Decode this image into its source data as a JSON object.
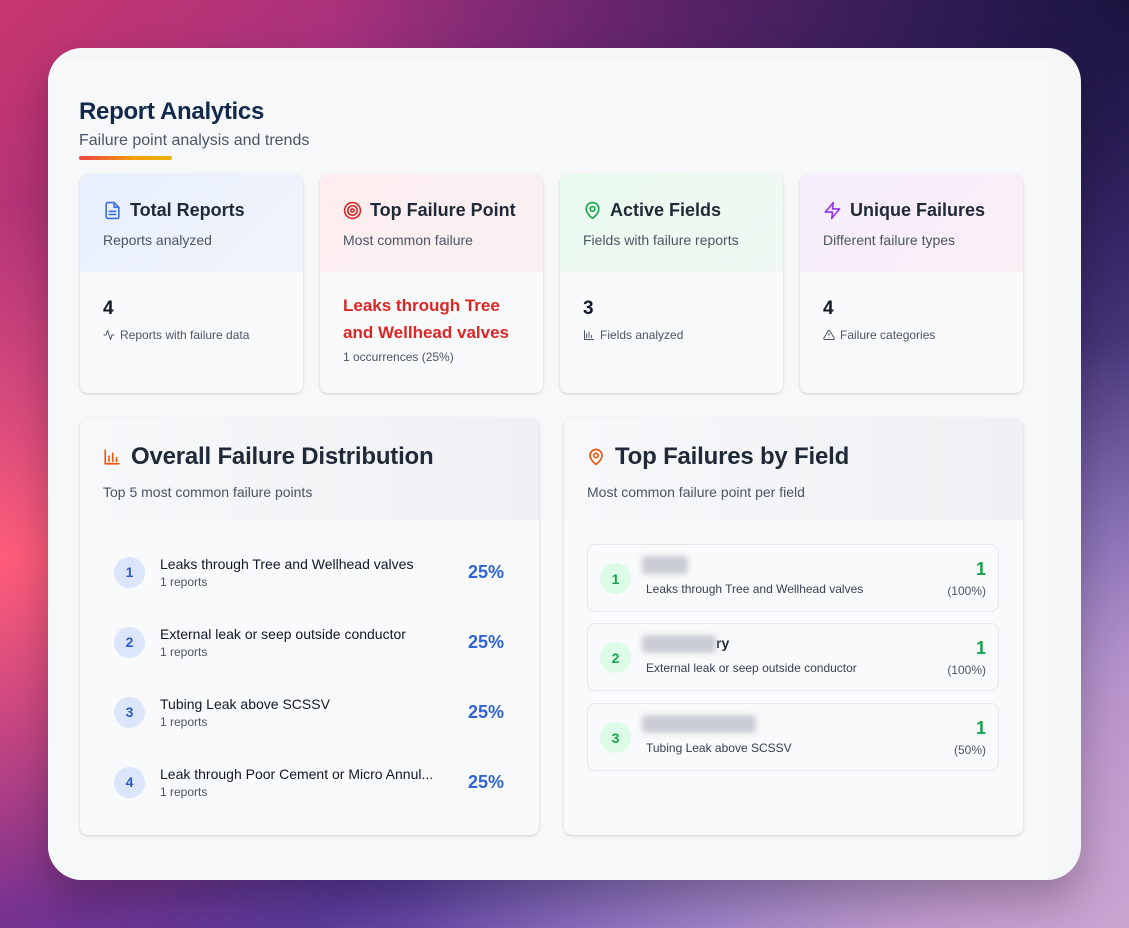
{
  "header": {
    "title": "Report Analytics",
    "subtitle": "Failure point analysis and trends"
  },
  "stats": [
    {
      "title": "Total Reports",
      "subtitle": "Reports analyzed",
      "value": "4",
      "note": "Reports with failure data",
      "icon": "document-icon",
      "color": "#3b6fd8"
    },
    {
      "title": "Top Failure Point",
      "subtitle": "Most common failure",
      "value": "Leaks through Tree and Wellhead valves",
      "note": "1 occurrences (25%)",
      "icon": "target-icon",
      "color": "#dc2626"
    },
    {
      "title": "Active Fields",
      "subtitle": "Fields with failure reports",
      "value": "3",
      "note": "Fields analyzed",
      "icon": "map-pin-icon",
      "color": "#16a34a"
    },
    {
      "title": "Unique Failures",
      "subtitle": "Different failure types",
      "value": "4",
      "note": "Failure categories",
      "icon": "lightning-icon",
      "color": "#9333ea"
    }
  ],
  "distribution": {
    "title": "Overall Failure Distribution",
    "subtitle": "Top 5 most common failure points",
    "items": [
      {
        "rank": "1",
        "name": "Leaks through Tree and Wellhead valves",
        "count": "1 reports",
        "pct": "25%"
      },
      {
        "rank": "2",
        "name": "External leak or seep outside conductor",
        "count": "1 reports",
        "pct": "25%"
      },
      {
        "rank": "3",
        "name": "Tubing Leak above SCSSV",
        "count": "1 reports",
        "pct": "25%"
      },
      {
        "rank": "4",
        "name": "Leak through Poor Cement or Micro Annul...",
        "count": "1 reports",
        "pct": "25%"
      }
    ]
  },
  "by_field": {
    "title": "Top Failures by Field",
    "subtitle": "Most common failure point per field",
    "items": [
      {
        "rank": "1",
        "field": "",
        "failure": "Leaks through Tree and Wellhead valves",
        "value": "1",
        "pct": "(100%)"
      },
      {
        "rank": "2",
        "field": "ry",
        "failure": "External leak or seep outside conductor",
        "value": "1",
        "pct": "(100%)"
      },
      {
        "rank": "3",
        "field": "",
        "failure": "Tubing Leak above SCSSV",
        "value": "1",
        "pct": "(50%)"
      }
    ]
  }
}
